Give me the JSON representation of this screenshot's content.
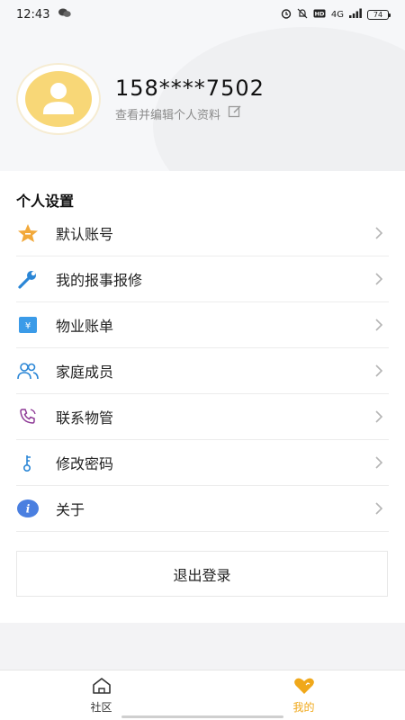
{
  "status_bar": {
    "time": "12:43",
    "network": "4G",
    "battery": "74"
  },
  "profile": {
    "phone": "158****7502",
    "edit_text": "查看并编辑个人资料"
  },
  "settings": {
    "title": "个人设置",
    "items": [
      {
        "label": "默认账号",
        "icon": "star-icon"
      },
      {
        "label": "我的报事报修",
        "icon": "wrench-icon"
      },
      {
        "label": "物业账单",
        "icon": "bill-icon"
      },
      {
        "label": "家庭成员",
        "icon": "family-icon"
      },
      {
        "label": "联系物管",
        "icon": "phone-icon"
      },
      {
        "label": "修改密码",
        "icon": "key-icon"
      },
      {
        "label": "关于",
        "icon": "info-icon"
      }
    ],
    "logout_label": "退出登录"
  },
  "bottom_nav": {
    "items": [
      {
        "label": "社区",
        "icon": "home-icon",
        "active": false
      },
      {
        "label": "我的",
        "icon": "heart-icon",
        "active": true
      }
    ]
  },
  "colors": {
    "accent": "#f0a81a",
    "avatar": "#f8d777"
  }
}
